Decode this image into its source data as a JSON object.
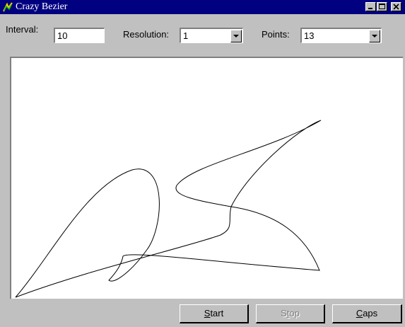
{
  "window": {
    "title": "Crazy Bezier",
    "minimize_icon": "minimize-icon",
    "maximize_icon": "maximize-icon",
    "close_icon": "close-icon"
  },
  "controls": {
    "interval_label": "Interval:",
    "interval_value": "10",
    "resolution_label": "Resolution:",
    "resolution_value": "1",
    "points_label": "Points:",
    "points_value": "13"
  },
  "buttons": {
    "start": "Start",
    "start_mnemonic": "S",
    "stop": "Stop",
    "stop_mnemonic": "t",
    "caps": "Caps",
    "caps_mnemonic": "C"
  },
  "colors": {
    "titlebar": "#000080",
    "face": "#c0c0c0",
    "canvas": "#ffffff",
    "curve": "#000000"
  }
}
